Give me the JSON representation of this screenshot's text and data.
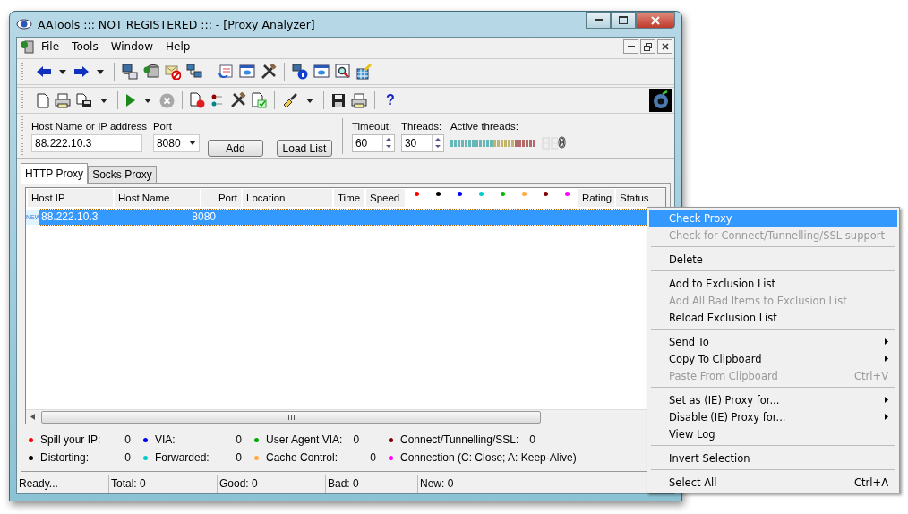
{
  "window": {
    "title": "AATools ::: NOT REGISTERED ::: - [Proxy Analyzer]"
  },
  "menu": [
    "File",
    "Tools",
    "Window",
    "Help"
  ],
  "toolbar": {
    "help": "?"
  },
  "form": {
    "host_label": "Host Name or IP address",
    "host_value": "88.222.10.3",
    "port_label": "Port",
    "port_value": "8080",
    "add": "Add",
    "load": "Load List",
    "timeout_label": "Timeout:",
    "timeout_value": "60",
    "threads_label": "Threads:",
    "threads_value": "30",
    "active_label": "Active threads:",
    "active_value": "0"
  },
  "tabs": [
    {
      "label": "HTTP Proxy",
      "selected": true
    },
    {
      "label": "Socks Proxy",
      "selected": false
    }
  ],
  "table": {
    "columns": [
      {
        "kind": "text",
        "label": "Host IP"
      },
      {
        "kind": "text",
        "label": "Host Name"
      },
      {
        "kind": "text",
        "label": "Port"
      },
      {
        "kind": "text",
        "label": "Location"
      },
      {
        "kind": "text",
        "label": "Time"
      },
      {
        "kind": "text",
        "label": "Speed"
      },
      {
        "kind": "dot",
        "color": "#ff0000"
      },
      {
        "kind": "dot",
        "color": "#000000"
      },
      {
        "kind": "dot",
        "color": "#0000ff"
      },
      {
        "kind": "dot",
        "color": "#00cccc"
      },
      {
        "kind": "dot",
        "color": "#00bb00"
      },
      {
        "kind": "dot",
        "color": "#ffaa44"
      },
      {
        "kind": "dot",
        "color": "#800000"
      },
      {
        "kind": "dot",
        "color": "#ff00ff"
      },
      {
        "kind": "text",
        "label": "Rating"
      },
      {
        "kind": "text",
        "label": "Status"
      }
    ],
    "rows": [
      {
        "badge": "NEW",
        "host_ip": "88.222.10.3",
        "port": "8080",
        "selected": true
      }
    ]
  },
  "legend": [
    {
      "color": "#ff0000",
      "label": "Spill your IP:",
      "value": "0"
    },
    {
      "color": "#0000ff",
      "label": "VIA:",
      "value": "0"
    },
    {
      "color": "#00aa00",
      "label": "User Agent VIA:",
      "value": "0"
    },
    {
      "color": "#800000",
      "label": "Connect/Tunnelling/SSL:",
      "value": "0"
    },
    {
      "color": "#000000",
      "label": "Distorting:",
      "value": "0"
    },
    {
      "color": "#00cccc",
      "label": "Forwarded:",
      "value": "0"
    },
    {
      "color": "#ffaa44",
      "label": "Cache Control:",
      "value": "0"
    },
    {
      "color": "#ff00ff",
      "label": "Connection (C: Close;  A: Keep-Alive)"
    }
  ],
  "status_bar": [
    "Ready...",
    "Total: 0",
    "Good: 0",
    "Bad: 0",
    "New: 0"
  ],
  "context_menu": [
    {
      "kind": "item",
      "label": "Check Proxy",
      "selected": true,
      "disabled": false
    },
    {
      "kind": "item",
      "label": "Check for Connect/Tunnelling/SSL support",
      "selected": false,
      "disabled": true
    },
    {
      "kind": "separator"
    },
    {
      "kind": "item",
      "label": "Delete",
      "selected": false,
      "disabled": false
    },
    {
      "kind": "separator"
    },
    {
      "kind": "item",
      "label": "Add to Exclusion List",
      "selected": false,
      "disabled": false
    },
    {
      "kind": "item",
      "label": "Add All Bad Items to Exclusion List",
      "selected": false,
      "disabled": true
    },
    {
      "kind": "item",
      "label": "Reload Exclusion List",
      "selected": false,
      "disabled": false
    },
    {
      "kind": "separator"
    },
    {
      "kind": "item",
      "label": "Send To",
      "selected": false,
      "disabled": false,
      "submenu": true
    },
    {
      "kind": "item",
      "label": "Copy To Clipboard",
      "selected": false,
      "disabled": false,
      "submenu": true
    },
    {
      "kind": "item",
      "label": "Paste From Clipboard",
      "selected": false,
      "disabled": true,
      "shortcut": "Ctrl+V"
    },
    {
      "kind": "separator"
    },
    {
      "kind": "item",
      "label": "Set as (IE) Proxy for...",
      "selected": false,
      "disabled": false,
      "submenu": true
    },
    {
      "kind": "item",
      "label": "Disable (IE) Proxy  for...",
      "selected": false,
      "disabled": false,
      "submenu": true
    },
    {
      "kind": "item",
      "label": "View Log",
      "selected": false,
      "disabled": false
    },
    {
      "kind": "separator"
    },
    {
      "kind": "item",
      "label": "Invert Selection",
      "selected": false,
      "disabled": false
    },
    {
      "kind": "separator"
    },
    {
      "kind": "item",
      "label": "Select All",
      "selected": false,
      "disabled": false,
      "shortcut": "Ctrl+A"
    }
  ]
}
